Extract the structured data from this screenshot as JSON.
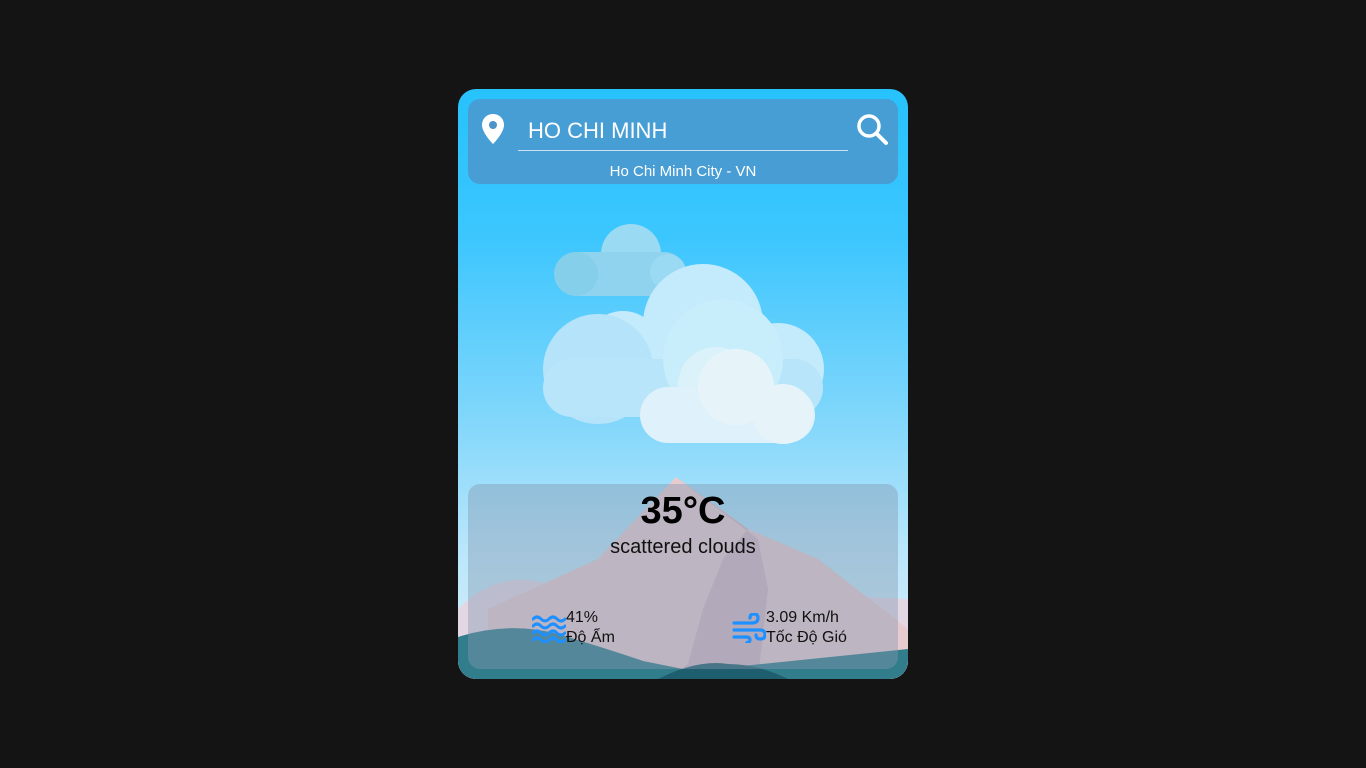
{
  "search": {
    "value": "HO CHI MINH",
    "location": "Ho Chi Minh City - VN"
  },
  "weather": {
    "temperature": "35°C",
    "description": "scattered clouds",
    "icon": "scattered-clouds-icon"
  },
  "stats": {
    "humidity": {
      "value": "41%",
      "label": "Độ Ẩm",
      "icon": "humidity-waves-icon"
    },
    "wind": {
      "value": "3.09 Km/h",
      "label": "Tốc Độ Gió",
      "icon": "wind-icon"
    }
  },
  "colors": {
    "accent_icon": "#1e90ff",
    "panel_text": "#ffffff",
    "page_background": "#141414"
  }
}
